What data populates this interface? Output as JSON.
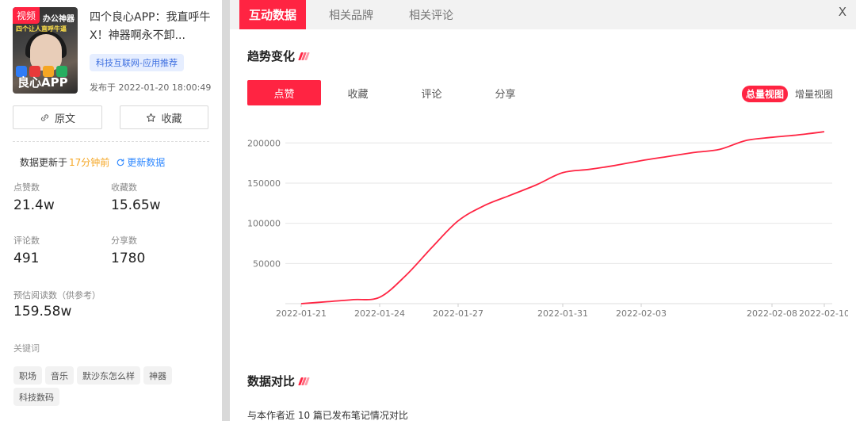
{
  "note": {
    "type_tag": "视频",
    "thumb_line1": "办公神器",
    "thumb_line2": "四个让人直呼牛逼",
    "thumb_badge": "良心APP",
    "title": "四个良心APP：我直呼牛X！神器啊永不卸...",
    "channel": "科技互联网-应用推荐",
    "published_label": "发布于",
    "published_time": "2022-01-20 18:00:49"
  },
  "actions": {
    "original_label": "原文",
    "favorite_label": "收藏"
  },
  "update": {
    "prefix": "数据更新于",
    "ago": "17分钟前",
    "refresh_label": "更新数据"
  },
  "stats": {
    "likes_label": "点赞数",
    "likes_value": "21.4w",
    "collects_label": "收藏数",
    "collects_value": "15.65w",
    "comments_label": "评论数",
    "comments_value": "491",
    "shares_label": "分享数",
    "shares_value": "1780",
    "reads_label": "预估阅读数（供参考）",
    "reads_value": "159.58w"
  },
  "keywords": {
    "label": "关键词",
    "items": [
      "职场",
      "音乐",
      "默沙东怎么样",
      "神器",
      "科技数码"
    ]
  },
  "tabs": {
    "items": [
      "互动数据",
      "相关品牌",
      "相关评论"
    ],
    "close": "X"
  },
  "trend": {
    "title": "趋势变化",
    "metrics": [
      "点赞",
      "收藏",
      "评论",
      "分享"
    ],
    "view_total": "总量视图",
    "view_increment": "增量视图"
  },
  "compare": {
    "title": "数据对比",
    "desc": "与本作者近 10 篇已发布笔记情况对比"
  },
  "colors": {
    "accent": "#ff2442",
    "link": "#2f88ff",
    "highlight": "#f5a623"
  },
  "chart_data": {
    "type": "line",
    "series": [
      {
        "values": [
          {
            "x": "2022-01-21",
            "y": 0
          },
          {
            "x": "2022-01-22",
            "y": 2500
          },
          {
            "x": "2022-01-23",
            "y": 5000
          },
          {
            "x": "2022-01-24",
            "y": 8000
          },
          {
            "x": "2022-01-25",
            "y": 35000
          },
          {
            "x": "2022-01-26",
            "y": 70000
          },
          {
            "x": "2022-01-27",
            "y": 103000
          },
          {
            "x": "2022-01-28",
            "y": 122000
          },
          {
            "x": "2022-01-29",
            "y": 135000
          },
          {
            "x": "2022-01-30",
            "y": 148000
          },
          {
            "x": "2022-01-31",
            "y": 163000
          },
          {
            "x": "2022-02-01",
            "y": 167000
          },
          {
            "x": "2022-02-02",
            "y": 172000
          },
          {
            "x": "2022-02-03",
            "y": 178000
          },
          {
            "x": "2022-02-04",
            "y": 183000
          },
          {
            "x": "2022-02-05",
            "y": 188000
          },
          {
            "x": "2022-02-06",
            "y": 192000
          },
          {
            "x": "2022-02-07",
            "y": 203000
          },
          {
            "x": "2022-02-08",
            "y": 207000
          },
          {
            "x": "2022-02-09",
            "y": 210000
          },
          {
            "x": "2022-02-10",
            "y": 214000
          }
        ]
      }
    ],
    "x_ticks": [
      "2022-01-21",
      "2022-01-24",
      "2022-01-27",
      "2022-01-31",
      "2022-02-03",
      "2022-02-08",
      "2022-02-10"
    ],
    "y_ticks": [
      50000,
      100000,
      150000,
      200000
    ],
    "ylim": [
      0,
      220000
    ],
    "grid": true,
    "line_color": "#ff2442"
  }
}
